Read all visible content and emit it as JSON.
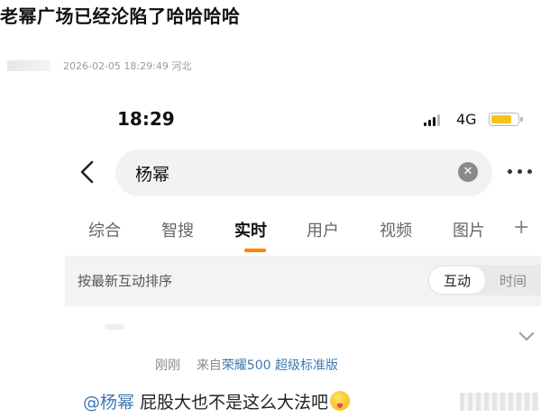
{
  "post": {
    "title": "老幂广场已经沦陷了哈哈哈哈",
    "meta": "2026-02-05 18:29:49 河北"
  },
  "status_bar": {
    "time": "18:29",
    "network": "4G",
    "battery_color": "#f6c31e"
  },
  "search": {
    "value": "杨幂",
    "clear_icon": "clear-icon"
  },
  "tabs": [
    {
      "label": "综合",
      "active": false
    },
    {
      "label": "智搜",
      "active": false
    },
    {
      "label": "实时",
      "active": true
    },
    {
      "label": "用户",
      "active": false
    },
    {
      "label": "视频",
      "active": false
    },
    {
      "label": "图片",
      "active": false
    }
  ],
  "tab_plus": "+",
  "sort": {
    "label": "按最新互动排序",
    "options": [
      "互动",
      "时间"
    ],
    "selected": "互动"
  },
  "feed": {
    "time": "刚刚",
    "from_prefix": "来自",
    "device": "荣耀500 超级标准版",
    "mention": "@杨幂",
    "text": " 屁股大也不是这么大法吧"
  },
  "colors": {
    "accent": "#ff8200",
    "link": "#3f78b3"
  }
}
